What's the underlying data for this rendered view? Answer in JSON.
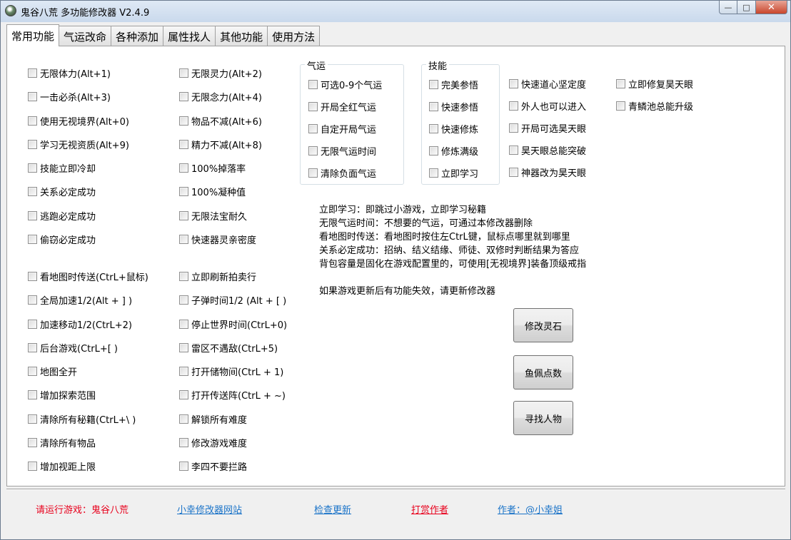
{
  "window": {
    "title": "鬼谷八荒 多功能修改器  V2.4.9"
  },
  "tabs": [
    "常用功能",
    "气运改命",
    "各种添加",
    "属性找人",
    "其他功能",
    "使用方法"
  ],
  "left_col1": [
    "无限体力(Alt+1)",
    "一击必杀(Alt+3)",
    "使用无视境界(Alt+0)",
    "学习无视资质(Alt+9)",
    "技能立即冷却",
    "关系必定成功",
    "逃跑必定成功",
    "偷窃必定成功",
    "看地图时传送(CtrL+鼠标)",
    "全局加速1/2(Alt + ] )",
    "加速移动1/2(CtrL+2)",
    "后台游戏(CtrL+[ )",
    "地图全开",
    "增加探索范围",
    "清除所有秘籍(CtrL+\\ )",
    "清除所有物品",
    "增加视距上限"
  ],
  "left_col2": [
    "无限灵力(Alt+2)",
    "无限念力(Alt+4)",
    "物品不减(Alt+6)",
    "精力不减(Alt+8)",
    "100%掉落率",
    "100%凝种值",
    "无限法宝耐久",
    "快速器灵亲密度",
    "立即刷新拍卖行",
    "子弹时间1/2 (Alt + [ )",
    "停止世界时间(CtrL+0)",
    "雷区不遇敌(CtrL+5)",
    "打开储物间(CtrL + 1)",
    "打开传送阵(CtrL + ~)",
    "解锁所有难度",
    "修改游戏难度",
    "李四不要拦路"
  ],
  "qiyun": {
    "title": "气运",
    "items": [
      "可选0-9个气运",
      "开局全红气运",
      "自定开局气运",
      "无限气运时间",
      "清除负面气运"
    ]
  },
  "jineng": {
    "title": "技能",
    "items": [
      "完美参悟",
      "快速参悟",
      "快速修炼",
      "修炼满级",
      "立即学习"
    ]
  },
  "right_col1": [
    "快速道心坚定度",
    "外人也可以进入",
    "开局可选昊天眼",
    "昊天眼总能突破",
    "神器改为昊天眼"
  ],
  "right_col2": [
    "立即修复昊天眼",
    "青鳞池总能升级"
  ],
  "notes": [
    "立即学习：即跳过小游戏，立即学习秘籍",
    "无限气运时间：不想要的气运，可通过本修改器删除",
    "看地图时传送：看地图时按住左CtrL键，鼠标点哪里就到哪里",
    "关系必定成功：招纳、结义结缘、师徒、双修时判断结果为答应",
    "背包容量是固化在游戏配置里的，可使用[无视境界]装备顶级戒指",
    "如果游戏更新后有功能失效，请更新修改器"
  ],
  "buttons": {
    "spirit_stone": "修改灵石",
    "fish_points": "鱼佩点数",
    "find_person": "寻找人物"
  },
  "footer": {
    "status": "请运行游戏：鬼谷八荒",
    "website": "小幸修改器网站",
    "check_update": "检查更新",
    "donate": "打赏作者",
    "author": "作者：@小幸姐"
  },
  "colors": {
    "status_red": "#e8001c",
    "link_blue": "#1a73c8"
  }
}
